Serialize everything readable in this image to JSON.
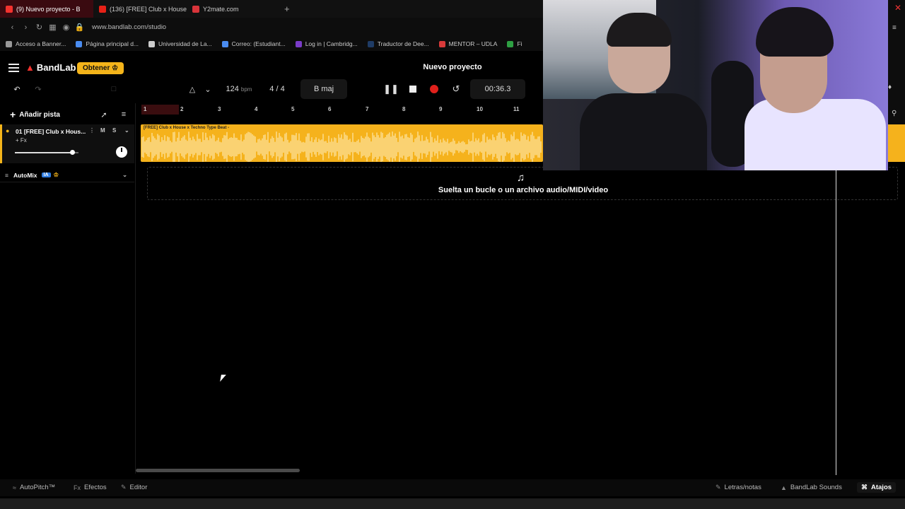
{
  "browser": {
    "tabs": [
      {
        "label": "(9) Nuevo proyecto - B",
        "active": true,
        "icon": "bandlab-icon"
      },
      {
        "label": "(136) [FREE] Club x House",
        "active": false,
        "icon": "youtube-icon"
      },
      {
        "label": "Y2mate.com",
        "active": false,
        "icon": "y2mate-icon"
      }
    ],
    "url": "www.bandlab.com/studio",
    "bookmarks": [
      {
        "label": "Acceso a Banner...",
        "color": "#999999"
      },
      {
        "label": "Página principal d...",
        "color": "#4a8cf0"
      },
      {
        "label": "Universidad de La...",
        "color": "#cccccc"
      },
      {
        "label": "Correo: (Estudiant...",
        "color": "#4a8cf0"
      },
      {
        "label": "Log in | Cambridg...",
        "color": "#7a3cc8"
      },
      {
        "label": "Traductor de Dee...",
        "color": "#1f3c66"
      },
      {
        "label": "MENTOR – UDLA",
        "color": "#d83a3a"
      },
      {
        "label": "Fi",
        "color": "#2ea043"
      }
    ]
  },
  "app": {
    "logo": "BandLab",
    "obtener": "Obtener",
    "project_title": "Nuevo proyecto"
  },
  "toolbar": {
    "bpm": "124",
    "bpm_unit": "bpm",
    "time_sig": "4 / 4",
    "key": "B maj",
    "time": "00:36.3"
  },
  "tracks": {
    "add_track": "Añadir pista",
    "items": [
      {
        "name": "01  [FREE] Club x Hous...",
        "mute": "M",
        "solo": "S",
        "fx": "+ Fx",
        "clip_label": "[FREE] Club x House x Techno Type Beat -",
        "volume": 0.9
      }
    ],
    "automix": "AutoMix",
    "automix_badge": "IA"
  },
  "ruler": {
    "ticks": [
      "1",
      "2",
      "3",
      "4",
      "5",
      "6",
      "7",
      "8",
      "9",
      "10",
      "11"
    ]
  },
  "dropzone": {
    "text": "Suelta un bucle o un archivo audio/MIDI/video"
  },
  "footer": {
    "autopitch": "AutoPitch™",
    "efectos": "Efectos",
    "editor": "Editor",
    "letras": "Letras/notas",
    "sounds": "BandLab Sounds",
    "atajos": "Atajos"
  },
  "colors": {
    "accent": "#f4b41a",
    "record": "#e0201b",
    "brand_red": "#f3322e"
  }
}
